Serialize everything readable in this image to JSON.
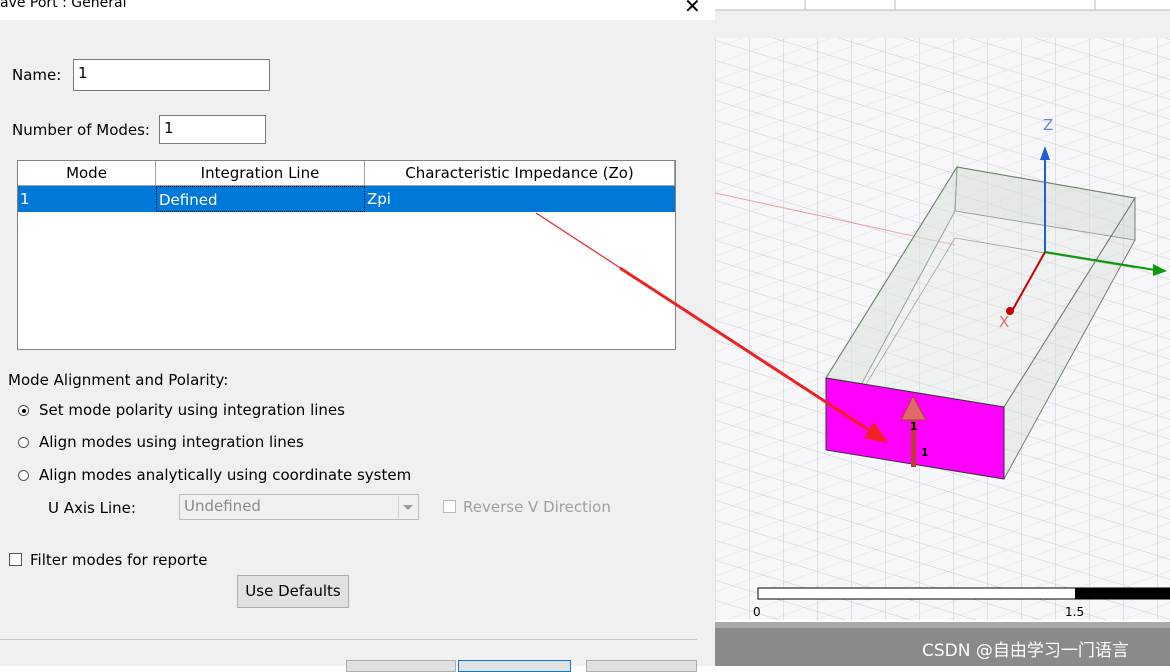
{
  "dialog": {
    "title": "ave Port : General",
    "name_label": "Name:",
    "name_value": "1",
    "modes_label": "Number of Modes:",
    "modes_value": "1",
    "table": {
      "headers": [
        "Mode",
        "Integration Line",
        "Characteristic Impedance (Zo)"
      ],
      "rows": [
        [
          "1",
          "Defined",
          "Zpi"
        ]
      ]
    },
    "alignment_heading": "Mode Alignment and Polarity:",
    "radios": [
      {
        "label": "Set mode polarity using integration lines",
        "checked": true
      },
      {
        "label": "Align modes using integration lines",
        "checked": false
      },
      {
        "label": "Align modes analytically using coordinate system",
        "checked": false
      }
    ],
    "u_axis_label": "U Axis Line:",
    "u_axis_value": "Undefined",
    "reverse_v_label": "Reverse V Direction",
    "filter_label": "Filter modes for reporter",
    "defaults_button": "Use Defaults"
  },
  "viewport": {
    "axis_labels": {
      "z": "Z",
      "x": "X"
    },
    "port_labels": [
      "1",
      "1"
    ],
    "scale": {
      "start": "0",
      "mid": "1.5"
    },
    "colors": {
      "port_face": "#ff00ff",
      "z_axis": "#1e5fd6",
      "y_axis": "#0a9a0a",
      "x_axis": "#cc0000",
      "annotation_arrow": "#ee2222"
    }
  },
  "watermark": "CSDN @自由学习一门语言"
}
